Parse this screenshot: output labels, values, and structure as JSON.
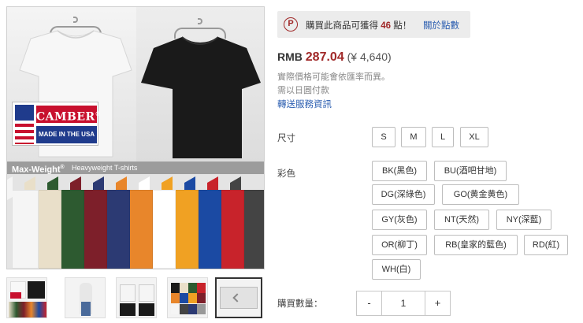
{
  "product_image": {
    "brand_name": "CAMBER",
    "brand_registered": "®",
    "made_in": "MADE IN THE USA",
    "line_title": "Max-Weight",
    "line_title_mark": "®",
    "line_subtitle": "Heavyweight T-shirts",
    "colors": {
      "brand_red": "#c8102e",
      "brand_blue": "#1f3b8c",
      "shirt_white": "#f7f7f7",
      "shirt_black": "#1a1a1a"
    },
    "tee_row_colors": [
      "#f5f5f5",
      "#e9dfc9",
      "#2d5a30",
      "#7d1f2a",
      "#2c3a73",
      "#e8862b",
      "#ffffff",
      "#f0a123",
      "#1b4aa3",
      "#c8232b",
      "#444444"
    ]
  },
  "thumbnails": [
    {
      "name": "thumb-1",
      "icon": "product-collage-icon"
    },
    {
      "name": "thumb-2",
      "icon": "model-wearing-icon"
    },
    {
      "name": "thumb-3",
      "icon": "front-back-icon"
    },
    {
      "name": "thumb-4",
      "icon": "color-grid-icon"
    },
    {
      "name": "thumb-5",
      "icon": "detail-view-icon"
    }
  ],
  "points": {
    "icon_letter": "P",
    "text_before": "購買此商品可獲得 ",
    "amount": "46",
    "text_after": " 點！",
    "link": "關於點數",
    "accent_color": "#a02828"
  },
  "price": {
    "currency": "RMB",
    "value": "287.04",
    "jpy": "(¥ 4,640)",
    "note_rate": "實際價格可能會依匯率而異。",
    "note_pay": "需以日圓付款",
    "shipping_link": "轉送服務資訊"
  },
  "options": {
    "size_label": "尺寸",
    "sizes": [
      "S",
      "M",
      "L",
      "XL"
    ],
    "color_label": "彩色",
    "colors": [
      "BK(黑色)",
      "BU(酒吧甘地)",
      "DG(深綠色)",
      "GO(黄金黄色)",
      "GY(灰色)",
      "NT(天然)",
      "NY(深藍)",
      "OR(柳丁)",
      "RB(皇家的藍色)",
      "RD(紅)",
      "WH(白)"
    ]
  },
  "quantity": {
    "label": "購買數量：",
    "minus": "-",
    "value": "1",
    "plus": "+"
  }
}
